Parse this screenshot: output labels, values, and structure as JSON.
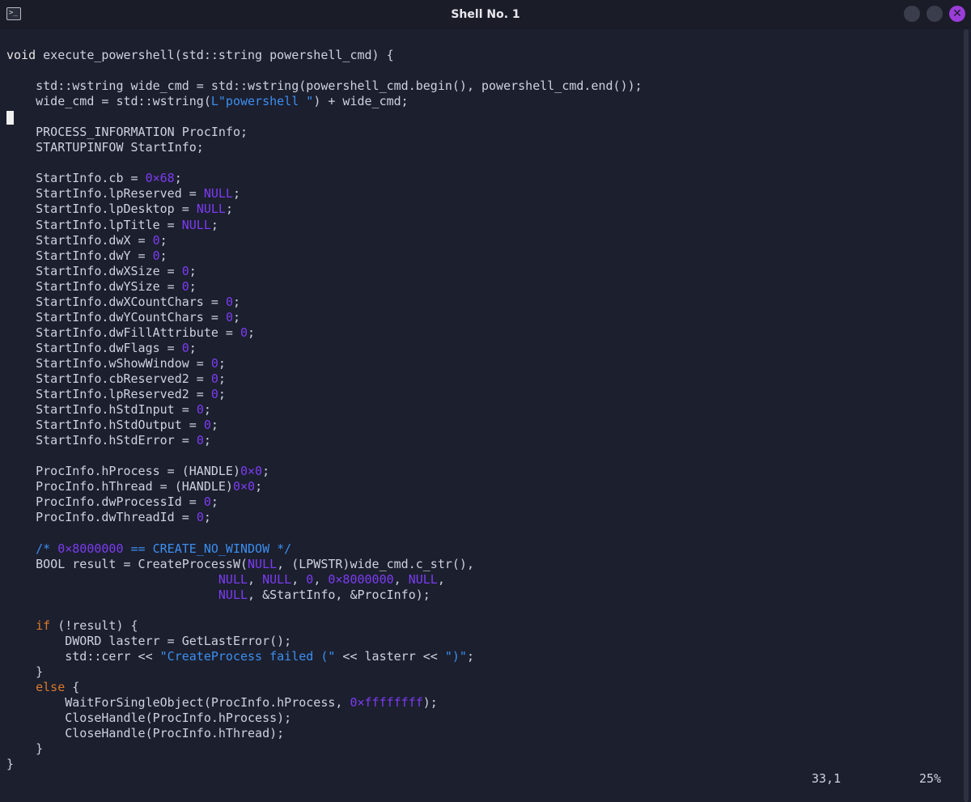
{
  "window": {
    "title": "Shell No. 1",
    "terminal_icon": "terminal-icon",
    "close_glyph": "✕"
  },
  "editor": {
    "lines": [
      [
        {
          "t": "void",
          "c": "kw"
        },
        {
          "t": " execute_powershell(std::string powershell_cmd) {"
        }
      ],
      [],
      [
        {
          "t": "    std::wstring wide_cmd = std::wstring(powershell_cmd.begin(), powershell_cmd.end());"
        }
      ],
      [
        {
          "t": "    wide_cmd = std::wstring("
        },
        {
          "t": "L\"powershell \"",
          "c": "str"
        },
        {
          "t": ") + wide_cmd;"
        }
      ],
      [],
      [
        {
          "t": "    PROCESS_INFORMATION ProcInfo;"
        }
      ],
      [
        {
          "t": "    STARTUPINFOW StartInfo;"
        }
      ],
      [],
      [
        {
          "t": "    StartInfo.cb = "
        },
        {
          "t": "0×68",
          "c": "num"
        },
        {
          "t": ";"
        }
      ],
      [
        {
          "t": "    StartInfo.lpReserved = "
        },
        {
          "t": "NULL",
          "c": "num"
        },
        {
          "t": ";"
        }
      ],
      [
        {
          "t": "    StartInfo.lpDesktop = "
        },
        {
          "t": "NULL",
          "c": "num"
        },
        {
          "t": ";"
        }
      ],
      [
        {
          "t": "    StartInfo.lpTitle = "
        },
        {
          "t": "NULL",
          "c": "num"
        },
        {
          "t": ";"
        }
      ],
      [
        {
          "t": "    StartInfo.dwX = "
        },
        {
          "t": "0",
          "c": "num"
        },
        {
          "t": ";"
        }
      ],
      [
        {
          "t": "    StartInfo.dwY = "
        },
        {
          "t": "0",
          "c": "num"
        },
        {
          "t": ";"
        }
      ],
      [
        {
          "t": "    StartInfo.dwXSize = "
        },
        {
          "t": "0",
          "c": "num"
        },
        {
          "t": ";"
        }
      ],
      [
        {
          "t": "    StartInfo.dwYSize = "
        },
        {
          "t": "0",
          "c": "num"
        },
        {
          "t": ";"
        }
      ],
      [
        {
          "t": "    StartInfo.dwXCountChars = "
        },
        {
          "t": "0",
          "c": "num"
        },
        {
          "t": ";"
        }
      ],
      [
        {
          "t": "    StartInfo.dwYCountChars = "
        },
        {
          "t": "0",
          "c": "num"
        },
        {
          "t": ";"
        }
      ],
      [
        {
          "t": "    StartInfo.dwFillAttribute = "
        },
        {
          "t": "0",
          "c": "num"
        },
        {
          "t": ";"
        }
      ],
      [
        {
          "t": "    StartInfo.dwFlags = "
        },
        {
          "t": "0",
          "c": "num"
        },
        {
          "t": ";"
        }
      ],
      [
        {
          "t": "    StartInfo.wShowWindow = "
        },
        {
          "t": "0",
          "c": "num"
        },
        {
          "t": ";"
        }
      ],
      [
        {
          "t": "    StartInfo.cbReserved2 = "
        },
        {
          "t": "0",
          "c": "num"
        },
        {
          "t": ";"
        }
      ],
      [
        {
          "t": "    StartInfo.lpReserved2 = "
        },
        {
          "t": "0",
          "c": "num"
        },
        {
          "t": ";"
        }
      ],
      [
        {
          "t": "    StartInfo.hStdInput = "
        },
        {
          "t": "0",
          "c": "num"
        },
        {
          "t": ";"
        }
      ],
      [
        {
          "t": "    StartInfo.hStdOutput = "
        },
        {
          "t": "0",
          "c": "num"
        },
        {
          "t": ";"
        }
      ],
      [
        {
          "t": "    StartInfo.hStdError = "
        },
        {
          "t": "0",
          "c": "num"
        },
        {
          "t": ";"
        }
      ],
      [],
      [
        {
          "t": "    ProcInfo.hProcess = (HANDLE)"
        },
        {
          "t": "0×0",
          "c": "num"
        },
        {
          "t": ";"
        }
      ],
      [
        {
          "t": "    ProcInfo.hThread = (HANDLE)"
        },
        {
          "t": "0×0",
          "c": "num"
        },
        {
          "t": ";"
        }
      ],
      [
        {
          "t": "    ProcInfo.dwProcessId = "
        },
        {
          "t": "0",
          "c": "num"
        },
        {
          "t": ";"
        }
      ],
      [
        {
          "t": "    ProcInfo.dwThreadId = "
        },
        {
          "t": "0",
          "c": "num"
        },
        {
          "t": ";"
        }
      ],
      [],
      [
        {
          "t": "    "
        },
        {
          "t": "/* ",
          "c": "cmt"
        },
        {
          "t": "0×8000000",
          "c": "num"
        },
        {
          "t": " == CREATE_NO_WINDOW */",
          "c": "cmt"
        }
      ],
      [
        {
          "t": "    BOOL result = CreateProcessW("
        },
        {
          "t": "NULL",
          "c": "num"
        },
        {
          "t": ", (LPWSTR)wide_cmd.c_str(),"
        }
      ],
      [
        {
          "t": "                             "
        },
        {
          "t": "NULL",
          "c": "num"
        },
        {
          "t": ", "
        },
        {
          "t": "NULL",
          "c": "num"
        },
        {
          "t": ", "
        },
        {
          "t": "0",
          "c": "num"
        },
        {
          "t": ", "
        },
        {
          "t": "0×8000000",
          "c": "num"
        },
        {
          "t": ", "
        },
        {
          "t": "NULL",
          "c": "num"
        },
        {
          "t": ","
        }
      ],
      [
        {
          "t": "                             "
        },
        {
          "t": "NULL",
          "c": "num"
        },
        {
          "t": ", &StartInfo, &ProcInfo);"
        }
      ],
      [],
      [
        {
          "t": "    "
        },
        {
          "t": "if",
          "c": "ctl"
        },
        {
          "t": " (!result) {"
        }
      ],
      [
        {
          "t": "        DWORD lasterr = GetLastError();"
        }
      ],
      [
        {
          "t": "        std::cerr << "
        },
        {
          "t": "\"CreateProcess failed (\"",
          "c": "str"
        },
        {
          "t": " << lasterr << "
        },
        {
          "t": "\")\"",
          "c": "str"
        },
        {
          "t": ";"
        }
      ],
      [
        {
          "t": "    }"
        }
      ],
      [
        {
          "t": "    "
        },
        {
          "t": "else",
          "c": "ctl"
        },
        {
          "t": " {"
        }
      ],
      [
        {
          "t": "        WaitForSingleObject(ProcInfo.hProcess, "
        },
        {
          "t": "0×ffffffff",
          "c": "num"
        },
        {
          "t": ");"
        }
      ],
      [
        {
          "t": "        CloseHandle(ProcInfo.hProcess);"
        }
      ],
      [
        {
          "t": "        CloseHandle(ProcInfo.hThread);"
        }
      ],
      [
        {
          "t": "    }"
        }
      ],
      [
        {
          "t": "}"
        }
      ]
    ]
  },
  "statusline": {
    "position": "33,1",
    "percent": "25%"
  },
  "colors": {
    "background": "#1c1f2e",
    "text": "#cdd2e0",
    "number": "#7b3cf2",
    "string": "#3b8ff0",
    "control": "#d97a2a",
    "close_button": "#9b3dd9"
  }
}
